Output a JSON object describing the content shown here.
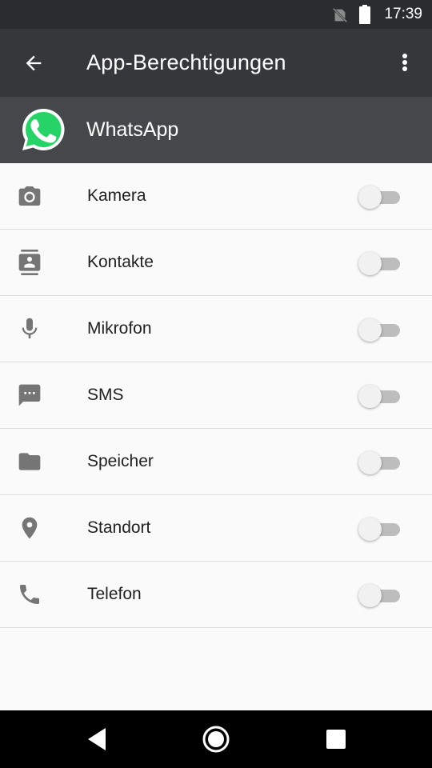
{
  "status_bar": {
    "time": "17:39",
    "icons": [
      "no-sim-icon",
      "battery-icon"
    ]
  },
  "toolbar": {
    "title": "App-Berechtigungen",
    "back_icon": "arrow-back-icon",
    "menu_icon": "more-vert-icon"
  },
  "app": {
    "name": "WhatsApp",
    "icon": "whatsapp-logo",
    "brand_color": "#25D366"
  },
  "permissions": [
    {
      "label": "Kamera",
      "icon": "camera-icon",
      "enabled": false
    },
    {
      "label": "Kontakte",
      "icon": "contacts-icon",
      "enabled": false
    },
    {
      "label": "Mikrofon",
      "icon": "microphone-icon",
      "enabled": false
    },
    {
      "label": "SMS",
      "icon": "sms-icon",
      "enabled": false
    },
    {
      "label": "Speicher",
      "icon": "folder-icon",
      "enabled": false
    },
    {
      "label": "Standort",
      "icon": "location-pin-icon",
      "enabled": false
    },
    {
      "label": "Telefon",
      "icon": "phone-icon",
      "enabled": false
    }
  ],
  "nav_bar": {
    "buttons": [
      "back-triangle-icon",
      "home-circle-icon",
      "recents-square-icon"
    ]
  },
  "colors": {
    "toolbar": "#35373b",
    "app_header": "#45474b",
    "status_bar": "#2a2c30",
    "icon_gray": "#757575"
  }
}
